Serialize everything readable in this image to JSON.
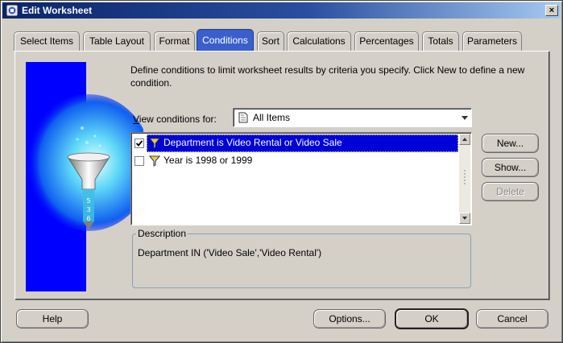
{
  "window": {
    "title": "Edit Worksheet",
    "close_label": "×"
  },
  "tabs": [
    {
      "label": "Select Items",
      "active": false
    },
    {
      "label": "Table Layout",
      "active": false
    },
    {
      "label": "Format",
      "active": false
    },
    {
      "label": "Conditions",
      "active": true
    },
    {
      "label": "Sort",
      "active": false
    },
    {
      "label": "Calculations",
      "active": false
    },
    {
      "label": "Percentages",
      "active": false
    },
    {
      "label": "Totals",
      "active": false
    },
    {
      "label": "Parameters",
      "active": false
    }
  ],
  "conditions_page": {
    "instruction": "Define conditions to limit worksheet results by criteria you specify. Click New to define a new condition.",
    "view_label_prefix": "V",
    "view_label_rest": "iew conditions for:",
    "view_selected": "All Items",
    "conditions": [
      {
        "label": "Department is Video Rental or Video Sale",
        "checked": true,
        "selected": true
      },
      {
        "label": "Year is 1998 or 1999",
        "checked": false,
        "selected": false
      }
    ],
    "buttons": {
      "new_label": "New...",
      "show_label": "Show...",
      "delete_label": "Delete"
    },
    "description_legend": "Description",
    "description_text": "Department IN ('Video Sale','Video Rental')"
  },
  "footer": {
    "help_label": "Help",
    "options_label": "Options...",
    "ok_label": "OK",
    "cancel_label": "Cancel"
  },
  "art": {
    "funnel_digits": [
      "5",
      "3",
      "6"
    ]
  },
  "colors": {
    "active_tab": "#3a5fcd",
    "selection": "#0000d8",
    "art_blue": "#0000ff"
  }
}
